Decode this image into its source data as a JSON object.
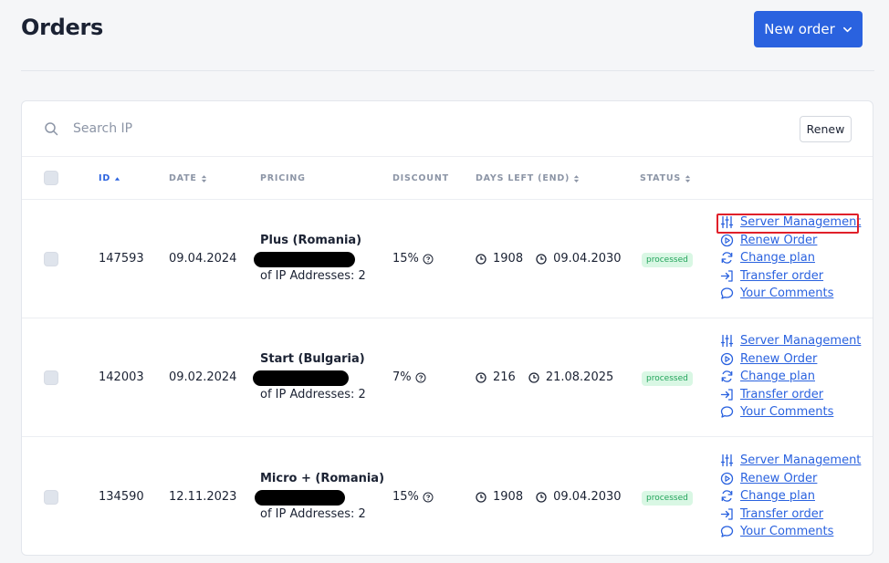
{
  "page": {
    "title": "Orders"
  },
  "header": {
    "new_order_label": "New order"
  },
  "search": {
    "placeholder": "Search IP",
    "renew_label": "Renew"
  },
  "table": {
    "columns": {
      "id": "ID",
      "date": "DATE",
      "pricing": "PRICING",
      "discount": "DISCOUNT",
      "days_left": "DAYS LEFT (END)",
      "status": "STATUS"
    },
    "actions": {
      "server_management": "Server Management",
      "renew_order": "Renew Order",
      "change_plan": "Change plan",
      "transfer_order": "Transfer order",
      "your_comments": "Your Comments"
    },
    "rows": [
      {
        "id": "147593",
        "date": "09.04.2024",
        "plan": "Plus (Romania)",
        "ip_count": "of IP Addresses: 2",
        "discount": "15%",
        "days": "1908",
        "end": "09.04.2030",
        "status": "processed"
      },
      {
        "id": "142003",
        "date": "09.02.2024",
        "plan": "Start (Bulgaria)",
        "ip_count": "of IP Addresses: 2",
        "discount": "7%",
        "days": "216",
        "end": "21.08.2025",
        "status": "processed"
      },
      {
        "id": "134590",
        "date": "12.11.2023",
        "plan": "Micro + (Romania)",
        "ip_count": "of IP Addresses: 2",
        "discount": "15%",
        "days": "1908",
        "end": "09.04.2030",
        "status": "processed"
      }
    ]
  },
  "colors": {
    "accent": "#2a62df",
    "status_bg": "#d9f7e4",
    "status_text": "#23a45b",
    "highlight": "#e0202a"
  },
  "icons": [
    "search-icon",
    "chevron-down-icon",
    "sort-icon",
    "help-icon",
    "clock-icon",
    "sliders-icon",
    "play-circle-icon",
    "refresh-icon",
    "transfer-icon",
    "comment-icon"
  ]
}
